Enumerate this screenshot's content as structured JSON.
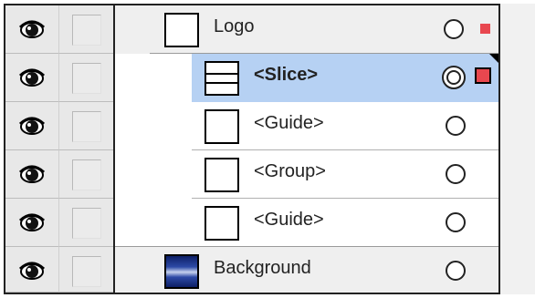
{
  "layers": [
    {
      "name": "Logo",
      "expanded": true,
      "indent": 0
    },
    {
      "name": "<Slice>",
      "selected": true,
      "indent": 1
    },
    {
      "name": "<Guide>",
      "indent": 1
    },
    {
      "name": "<Group>",
      "collapsed": true,
      "indent": 1
    },
    {
      "name": "<Guide>",
      "indent": 1
    },
    {
      "name": "Background",
      "collapsed": true,
      "indent": 0
    }
  ],
  "colors": {
    "selection": "#b6d1f3",
    "layer_color_logo": "#e8474f",
    "panel_bg": "#e8e8e8"
  }
}
